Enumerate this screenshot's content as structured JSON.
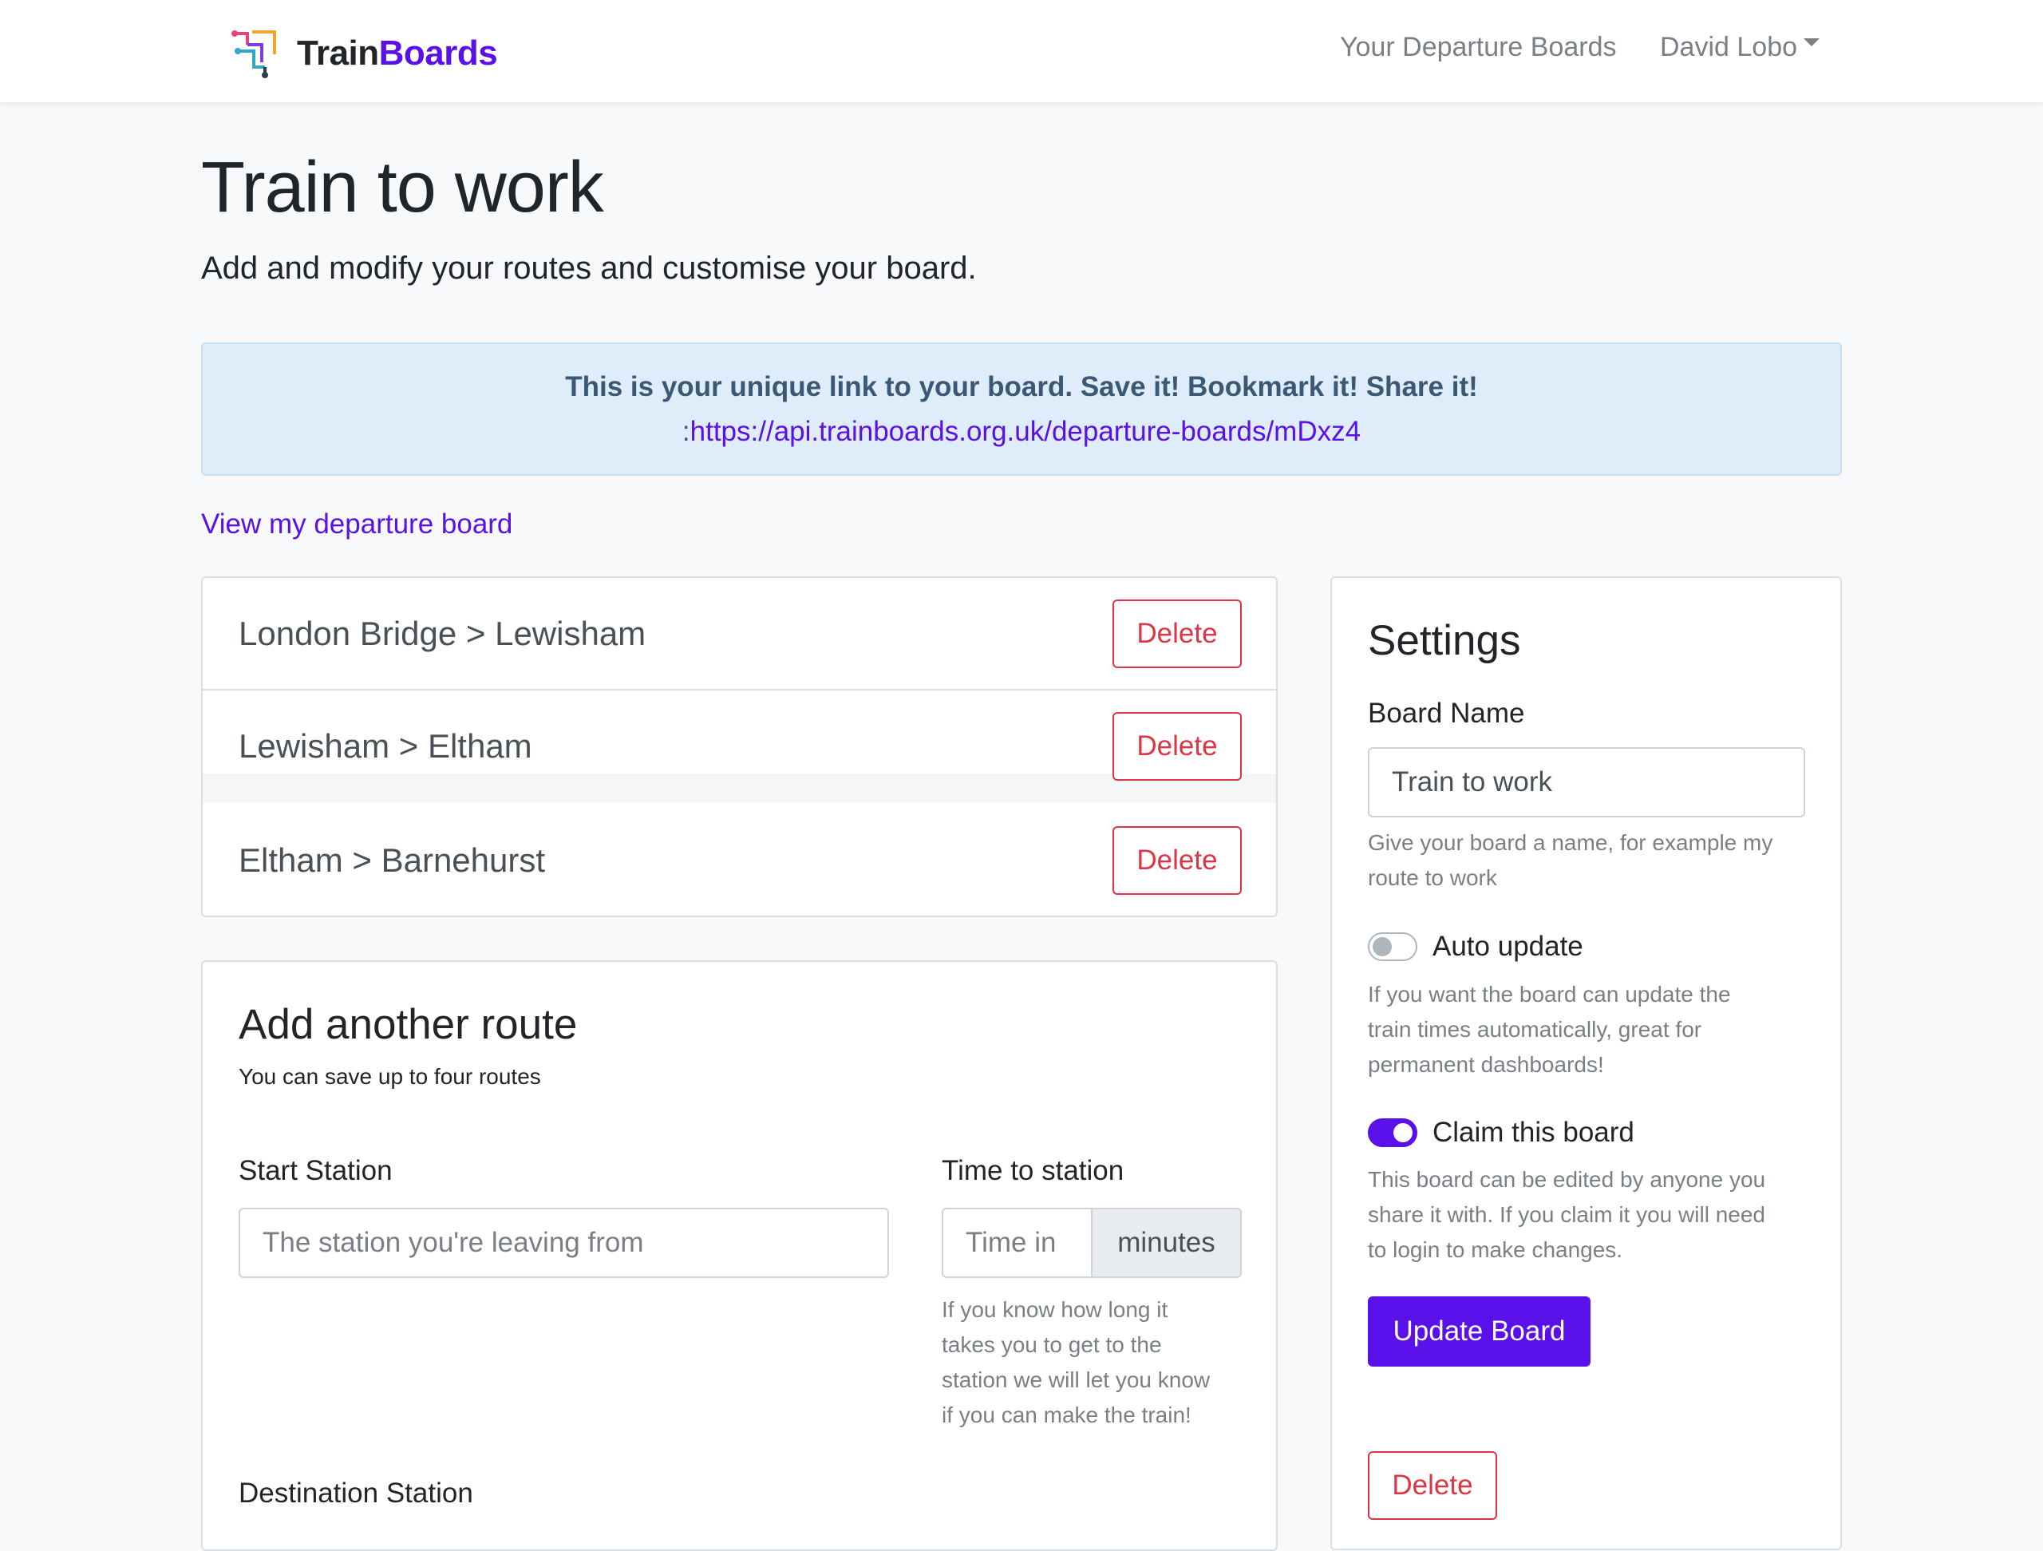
{
  "navbar": {
    "brand_train": "Train",
    "brand_boards": "Boards",
    "links": [
      "Your Departure Boards",
      "David Lobo"
    ]
  },
  "page": {
    "title": "Train to work",
    "subtitle": "Add and modify your routes and customise your board."
  },
  "alert": {
    "heading": "This is your unique link to your board. Save it! Bookmark it! Share it!",
    "prefix": ":",
    "link": "https://api.trainboards.org.uk/departure-boards/mDxz4"
  },
  "view_link": "View my departure board",
  "routes": [
    {
      "label": "London Bridge > Lewisham",
      "action": "Delete"
    },
    {
      "label": "Lewisham > Eltham",
      "action": "Delete"
    },
    {
      "label": "Eltham > Barnehurst",
      "action": "Delete"
    }
  ],
  "add_route": {
    "title": "Add another route",
    "subtitle": "You can save up to four routes",
    "start_label": "Start Station",
    "start_placeholder": "The station you're leaving from",
    "time_label": "Time to station",
    "time_placeholder": "Time in",
    "time_unit": "minutes",
    "time_help": [
      "If you know how long it",
      "takes you to get to the",
      "station we will let you know",
      "if you can make the train!"
    ],
    "destination_label": "Destination Station"
  },
  "settings": {
    "title": "Settings",
    "board_name_label": "Board Name",
    "board_name_value": "Train to work",
    "board_name_help": [
      "Give your board a name, for example my",
      "route to work"
    ],
    "auto_update_label": "Auto update",
    "auto_update_on": false,
    "auto_update_help": [
      "If you want the board can update the",
      "train times automatically, great for",
      "permanent dashboards!"
    ],
    "claim_label": "Claim this board",
    "claim_on": true,
    "claim_help": [
      "This board can be edited by anyone you",
      "share it with. If you claim it you will need",
      "to login to make changes."
    ],
    "update_button": "Update Board",
    "delete_button": "Delete"
  },
  "colors": {
    "brand": "#5a10e8",
    "danger": "#dc3545",
    "alert_bg": "#dfecf9"
  }
}
